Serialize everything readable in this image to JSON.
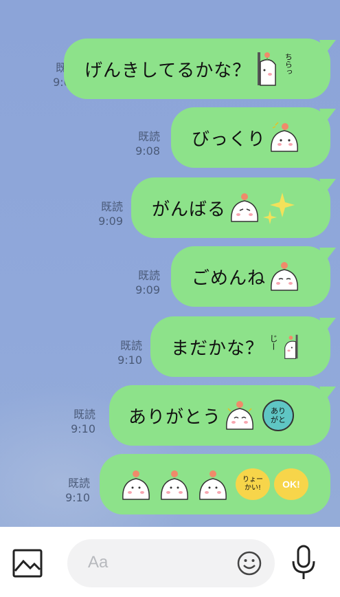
{
  "messages": [
    {
      "read": "既読",
      "time": "9:08",
      "text": "げんきしてるかな？",
      "emoji": "peek-flower",
      "deco_text": "ちらっ"
    },
    {
      "read": "既読",
      "time": "9:08",
      "text": "びっくり",
      "emoji": "surprised-flower"
    },
    {
      "read": "既読",
      "time": "9:09",
      "text": "がんばる",
      "emoji": "determined-flower",
      "deco": "sparkles"
    },
    {
      "read": "既読",
      "time": "9:09",
      "text": "ごめんね",
      "emoji": "sorry-flower"
    },
    {
      "read": "既読",
      "time": "9:10",
      "text": "まだかな？",
      "emoji": "waiting-peek",
      "deco_text": "じー"
    },
    {
      "read": "既読",
      "time": "9:10",
      "text": "ありがとう",
      "emoji": "thanks-flower",
      "badge_text": "ありがと"
    },
    {
      "read": "既読",
      "time": "9:10",
      "emoji": "three-waving-flowers",
      "badge_text": "りょーかい!",
      "badge2_text": "OK!"
    }
  ],
  "input": {
    "placeholder": "Aa"
  },
  "icons": {
    "left": "image-icon",
    "emoji": "smile-icon",
    "right": "mic-icon"
  },
  "colors": {
    "background": "#8ea6d8",
    "bubble": "#8de28a",
    "badge_teal": "#5fc6c4",
    "badge_yellow": "#f7d54a"
  }
}
